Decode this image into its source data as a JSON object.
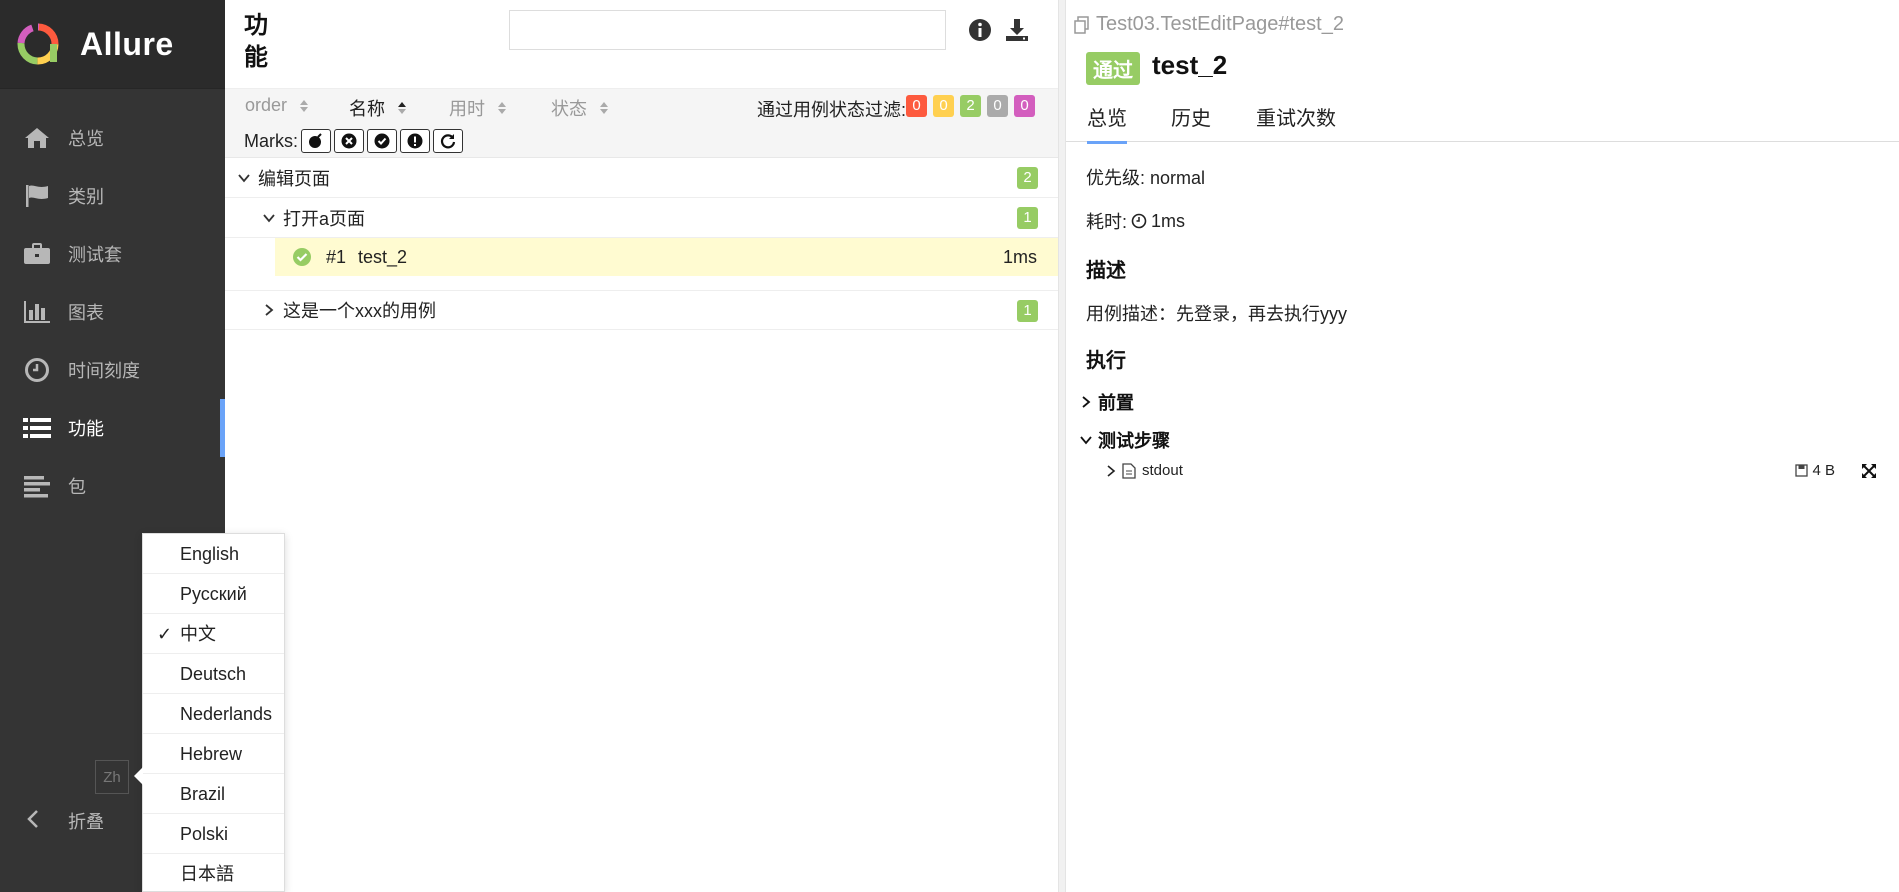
{
  "brand": {
    "name": "Allure"
  },
  "sidebar": {
    "items": [
      {
        "label": "总览",
        "icon": "home-icon"
      },
      {
        "label": "类别",
        "icon": "flag-icon"
      },
      {
        "label": "测试套",
        "icon": "briefcase-icon"
      },
      {
        "label": "图表",
        "icon": "bar-chart-icon"
      },
      {
        "label": "时间刻度",
        "icon": "clock-icon"
      },
      {
        "label": "功能",
        "icon": "list-icon",
        "active": true
      },
      {
        "label": "包",
        "icon": "align-left-icon"
      }
    ],
    "lang_button": "Zh",
    "collapse_label": "折叠"
  },
  "language_menu": {
    "items": [
      "English",
      "Русский",
      "中文",
      "Deutsch",
      "Nederlands",
      "Hebrew",
      "Brazil",
      "Polski",
      "日本語"
    ],
    "selected": "中文"
  },
  "tree_pane": {
    "title": "功能",
    "search": {
      "value": "",
      "placeholder": ""
    },
    "sort": [
      "order",
      "名称",
      "用时",
      "状态"
    ],
    "sort_active": "名称",
    "filter_label": "通过用例状态过滤:",
    "filter_counts": [
      {
        "value": "0",
        "color": "#fd5a3e"
      },
      {
        "value": "0",
        "color": "#ffd050"
      },
      {
        "value": "2",
        "color": "#97cc64"
      },
      {
        "value": "0",
        "color": "#aaaaaa"
      },
      {
        "value": "0",
        "color": "#d35ebe"
      }
    ],
    "marks_label": "Marks:",
    "groups": [
      {
        "label": "编辑页面",
        "count": "2"
      },
      {
        "label": "打开a页面",
        "count": "1"
      },
      {
        "label": "这是一个xxx的用例",
        "count": "1"
      }
    ],
    "case": {
      "order": "#1",
      "name": "test_2",
      "duration": "1ms"
    }
  },
  "detail": {
    "breadcrumb": "Test03.TestEditPage#test_2",
    "status": "通过",
    "status_color": "#97cc64",
    "name": "test_2",
    "tabs": [
      "总览",
      "历史",
      "重试次数"
    ],
    "severity": "优先级: normal",
    "duration_label": "耗时:",
    "duration_value": "1ms",
    "description_title": "描述",
    "description": "用例描述：先登录，再去执行yyy",
    "execution_title": "执行",
    "setup_label": "前置",
    "steps_label": "测试步骤",
    "attachment": {
      "name": "stdout",
      "size": "4 B"
    }
  }
}
